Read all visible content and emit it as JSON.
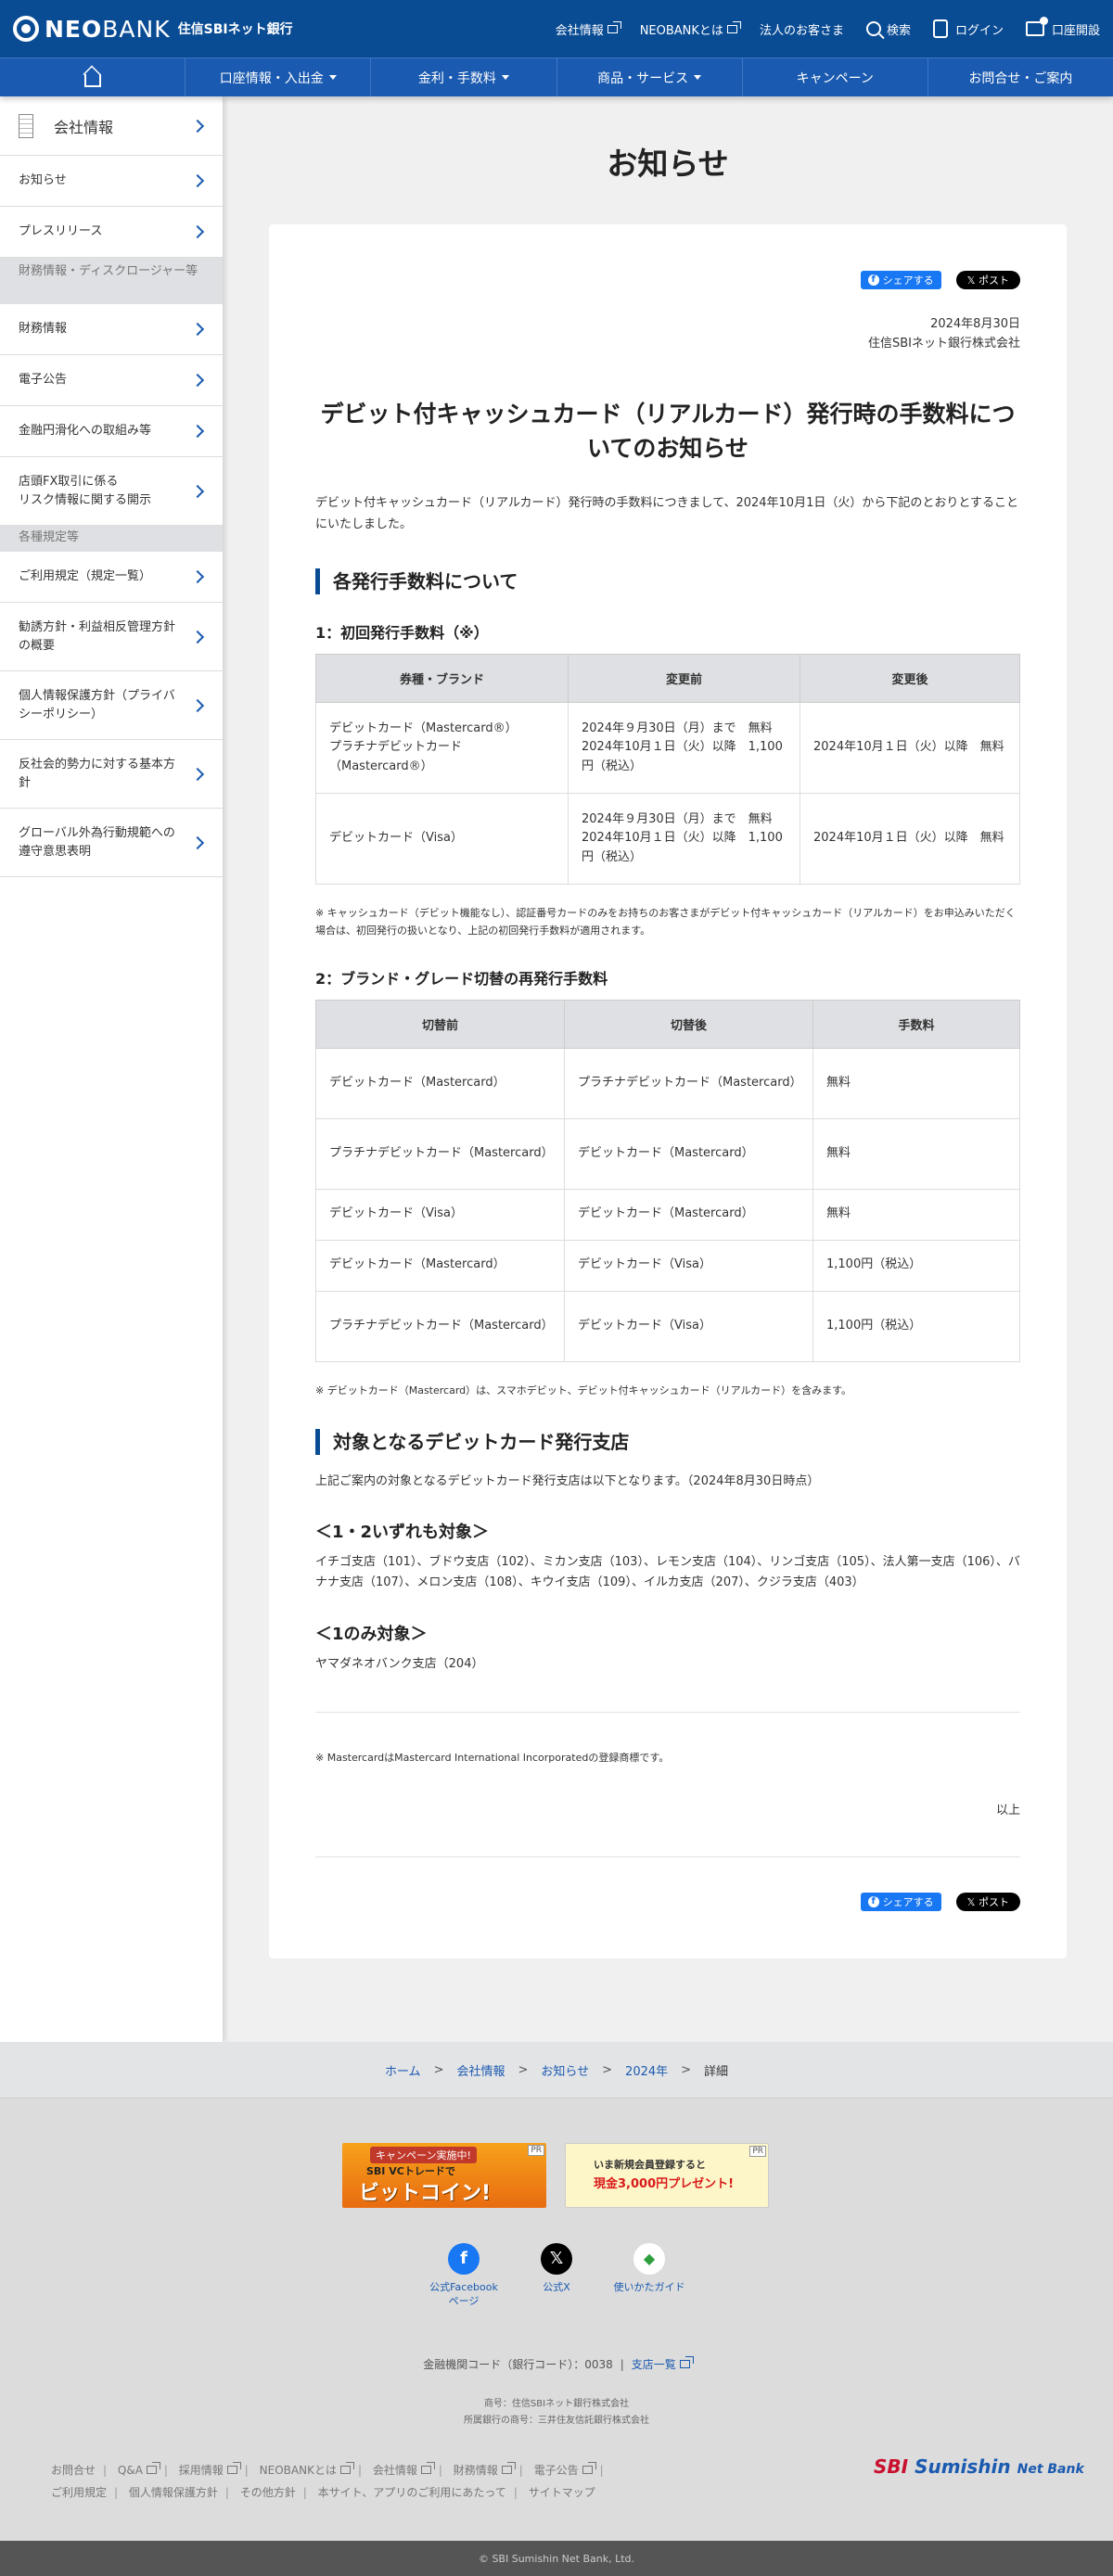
{
  "header": {
    "logo_neo": "NEO",
    "logo_bank": "BANK",
    "logo_sub": "住信SBIネット銀行",
    "links": [
      "会社情報",
      "NEOBANKとは",
      "法人のお客さま"
    ],
    "search": "検索",
    "login": "ログイン",
    "open_account": "口座開設"
  },
  "nav": [
    "口座情報・入出金",
    "金利・手数料",
    "商品・サービス",
    "キャンペーン",
    "お問合せ・ご案内"
  ],
  "sidebar": {
    "head": "会社情報",
    "items": [
      "お知らせ",
      "プレスリリース"
    ],
    "cat1": "財務情報・ディスクロージャー等",
    "items2": [
      "財務情報",
      "電子公告",
      "金融円滑化への取組み等",
      "店頭FX取引に係る\nリスク情報に関する開示"
    ],
    "cat2": "各種規定等",
    "items3": [
      "ご利用規定（規定一覧）",
      "勧誘方針・利益相反管理方針の概要",
      "個人情報保護方針（プライバシーポリシー）",
      "反社会的勢力に対する基本方針",
      "グローバル外為行動規範への遵守意思表明"
    ]
  },
  "page_title": "お知らせ",
  "share": {
    "fb": "シェアする",
    "x": "ポスト"
  },
  "article": {
    "date": "2024年8月30日",
    "company": "住信SBIネット銀行株式会社",
    "title": "デビット付キャッシュカード（リアルカード）発行時の手数料についてのお知らせ",
    "lead": "デビット付キャッシュカード（リアルカード）発行時の手数料につきまして、2024年10月1日（火）から下記のとおりとすることにいたしました。",
    "section1": "各発行手数料について",
    "sub1": "1：初回発行手数料（※）",
    "table1": {
      "headers": [
        "券種・ブランド",
        "変更前",
        "変更後"
      ],
      "rows": [
        [
          "デビットカード（Mastercard®）\nプラチナデビットカード（Mastercard®）",
          "2024年９月30日（月）まで　無料\n2024年10月１日（火）以降　1,100円（税込）",
          "2024年10月１日（火）以降　無料"
        ],
        [
          "デビットカード（Visa）",
          "2024年９月30日（月）まで　無料\n2024年10月１日（火）以降　1,100円（税込）",
          "2024年10月１日（火）以降　無料"
        ]
      ]
    },
    "note1": "※ キャッシュカード（デビット機能なし）、認証番号カードのみをお持ちのお客さまがデビット付キャッシュカード（リアルカード）をお申込みいただく場合は、初回発行の扱いとなり、上記の初回発行手数料が適用されます。",
    "sub2": "2：ブランド・グレード切替の再発行手数料",
    "table2": {
      "headers": [
        "切替前",
        "切替後",
        "手数料"
      ],
      "rows": [
        [
          "デビットカード（Mastercard）",
          "プラチナデビットカード（Mastercard）",
          "無料"
        ],
        [
          "プラチナデビットカード（Mastercard）",
          "デビットカード（Mastercard）",
          "無料"
        ],
        [
          "デビットカード（Visa）",
          "デビットカード（Mastercard）",
          "無料"
        ],
        [
          "デビットカード（Mastercard）",
          "デビットカード（Visa）",
          "1,100円（税込）"
        ],
        [
          "プラチナデビットカード（Mastercard）",
          "デビットカード（Visa）",
          "1,100円（税込）"
        ]
      ]
    },
    "note2": "※ デビットカード（Mastercard）は、スマホデビット、デビット付キャッシュカード（リアルカード）を含みます。",
    "section2": "対象となるデビットカード発行支店",
    "branches_intro": "上記ご案内の対象となるデビットカード発行支店は以下となります。（2024年8月30日時点）",
    "both_head": "＜1・2いずれも対象＞",
    "both_list": "イチゴ支店（101）、ブドウ支店（102）、ミカン支店（103）、レモン支店（104）、リンゴ支店（105）、法人第一支店（106）、バナナ支店（107）、メロン支店（108）、キウイ支店（109）、イルカ支店（207）、クジラ支店（403）",
    "one_head": "＜1のみ対象＞",
    "one_list": "ヤマダネオバンク支店（204）",
    "trademark": "※ MastercardはMastercard International Incorporatedの登録商標です。",
    "end": "以上"
  },
  "breadcrumb": [
    "ホーム",
    "会社情報",
    "お知らせ",
    "2024年",
    "詳細"
  ],
  "footer": {
    "banner1": {
      "pr": "PR",
      "t1": "キャンペーン実施中!",
      "t2": "SBI VCトレードで",
      "t3": "ビットコイン!"
    },
    "banner2": {
      "pr": "PR",
      "t1": "いま新規会員登録すると",
      "t2": "現金3,000円プレゼント!"
    },
    "social": [
      "公式Facebookページ",
      "公式X",
      "使いかたガイド"
    ],
    "bank_code": "金融機関コード（銀行コード）：0038",
    "branch_list": "支店一覧",
    "trade_name": "商号：住信SBIネット銀行株式会社",
    "affiliate": "所属銀行の商号：三井住友信託銀行株式会社",
    "links1": [
      "お問合せ",
      "Q&A",
      "採用情報",
      "NEOBANKとは",
      "会社情報",
      "財務情報",
      "電子公告"
    ],
    "links2": [
      "ご利用規定",
      "個人情報保護方針",
      "その他方針",
      "本サイト、アプリのご利用にあたって",
      "サイトマップ"
    ],
    "logo_sbi": "SBI",
    "logo_sumishin": "Sumishin",
    "logo_netbank": "Net Bank",
    "copyright": "© SBI Sumishin Net Bank, Ltd."
  }
}
